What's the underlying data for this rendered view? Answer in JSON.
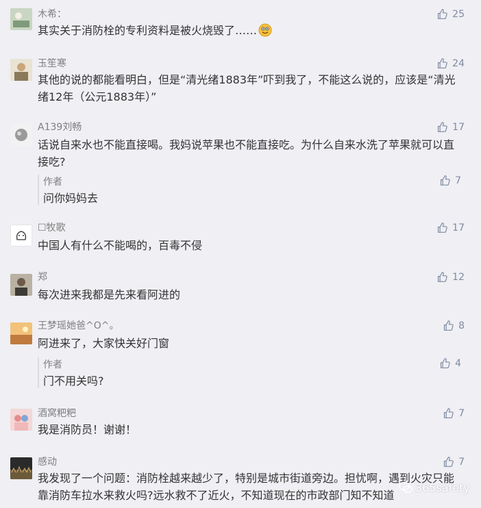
{
  "comments": [
    {
      "nick": "木希：",
      "text": "其实关于消防栓的专利资料是被火烧毁了……",
      "emoji": "grinning-face-icon",
      "likes": "25"
    },
    {
      "nick": "玉笙寒",
      "text": "其他的说的都能看明白，但是“清光绪1883年”吓到我了，不能这么说的，应该是“清光绪12年（公元1883年）”",
      "likes": "24"
    },
    {
      "nick": "A139刘畅",
      "text": "话说自来水也不能直接喝。我妈说苹果也不能直接吃。为什么自来水洗了苹果就可以直接吃?",
      "likes": "17",
      "reply": {
        "nick": "作者",
        "text": "问你妈妈去",
        "likes": "7"
      }
    },
    {
      "nick": "☐牧歌",
      "text": "中国人有什么不能喝的，百毒不侵",
      "likes": "17"
    },
    {
      "nick": "郑",
      "text": "每次进来我都是先来看阿进的",
      "likes": "12"
    },
    {
      "nick": "王梦瑶她爸^O^。",
      "text": "阿进来了，大家快关好门窗",
      "likes": "8",
      "reply": {
        "nick": "作者",
        "text": "门不用关吗?",
        "likes": "4"
      }
    },
    {
      "nick": "酒窝粑粑",
      "text": "我是消防员！谢谢！",
      "likes": "7"
    },
    {
      "nick": "感动",
      "text": "我发现了一个问题：消防栓越来越少了，特别是城市街道旁边。担忧啊，遇到火灾只能靠消防车拉水来救火吗?远水救不了近火，不知道现在的市政部门知不知道",
      "likes": "7"
    }
  ],
  "watermark": {
    "text": "365safety",
    "icon": "wechat-icon"
  },
  "colors": {
    "background": "#efeff4",
    "text": "#333333",
    "meta": "#808080",
    "like": "#7f8aa0"
  }
}
